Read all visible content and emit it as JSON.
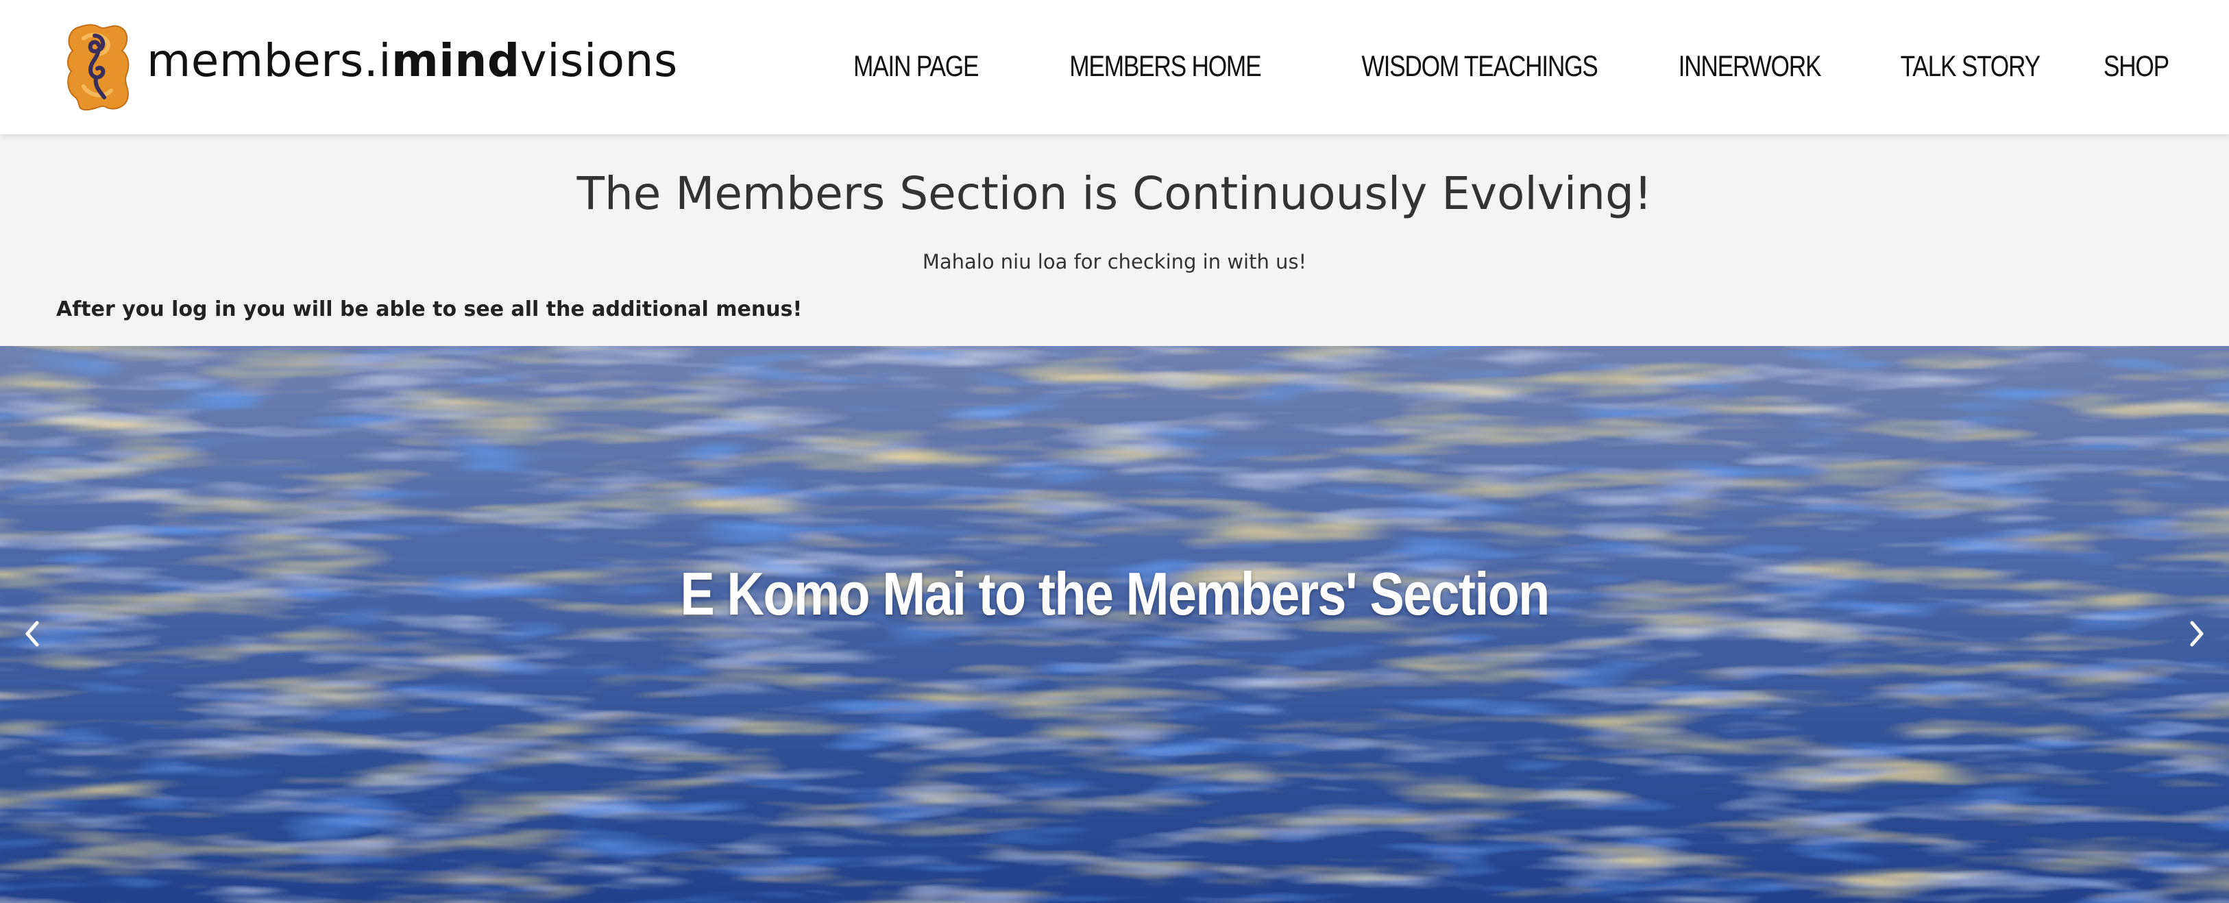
{
  "header": {
    "logo_text_prefix": "members.i",
    "logo_text_bold": "mind",
    "logo_text_suffix": "visions",
    "logo_icon": "sankofa-symbol-icon",
    "brand_color": "#e8932a"
  },
  "nav": {
    "items": [
      {
        "label": "MAIN PAGE"
      },
      {
        "label": "MEMBERS HOME"
      },
      {
        "label": "WISDOM TEACHINGS"
      },
      {
        "label": "INNERWORK"
      },
      {
        "label": "TALK STORY"
      },
      {
        "label": "SHOP"
      }
    ]
  },
  "notice": {
    "title": "The Members Section is Continuously Evolving!",
    "subtitle": "Mahalo niu loa for checking in with us!",
    "login_note": "After you log in you will be able to see all the additional menus!"
  },
  "hero": {
    "title": "E Komo Mai to the Members' Section",
    "prev_icon": "chevron-left-icon",
    "next_icon": "chevron-right-icon"
  }
}
